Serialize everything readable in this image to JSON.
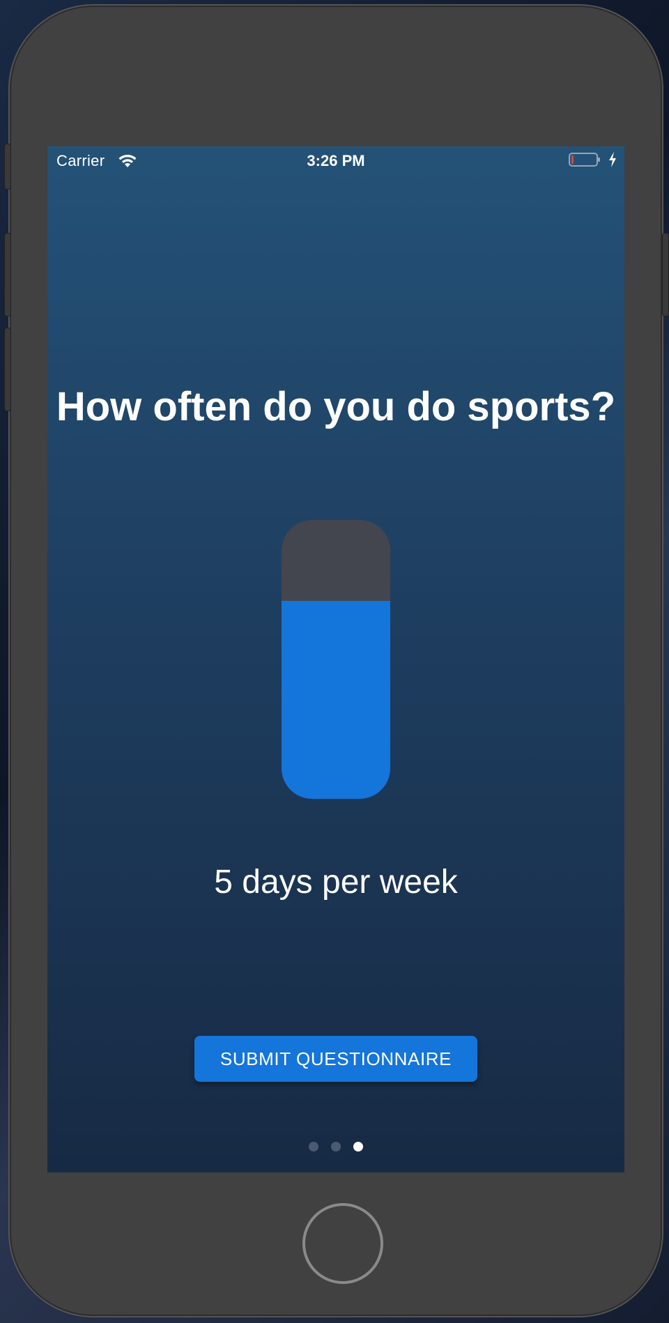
{
  "status_bar": {
    "carrier": "Carrier",
    "time": "3:26 PM",
    "wifi_icon": "wifi-icon",
    "battery_icon": "battery-low-icon",
    "charging_icon": "charging-bolt-icon"
  },
  "question": {
    "title": "How often do you do sports?"
  },
  "slider": {
    "fill_fraction": 0.71,
    "fill_color": "#1475db",
    "track_color": "#43464f"
  },
  "answer": {
    "value_label": "5 days per week"
  },
  "submit": {
    "label": "SUBMIT QUESTIONNAIRE",
    "color": "#1475db"
  },
  "pager": {
    "page_count": 3,
    "active_index": 2
  },
  "colors": {
    "background_top": "#245277",
    "background_bottom": "#172a44",
    "device_frame": "#414141"
  }
}
